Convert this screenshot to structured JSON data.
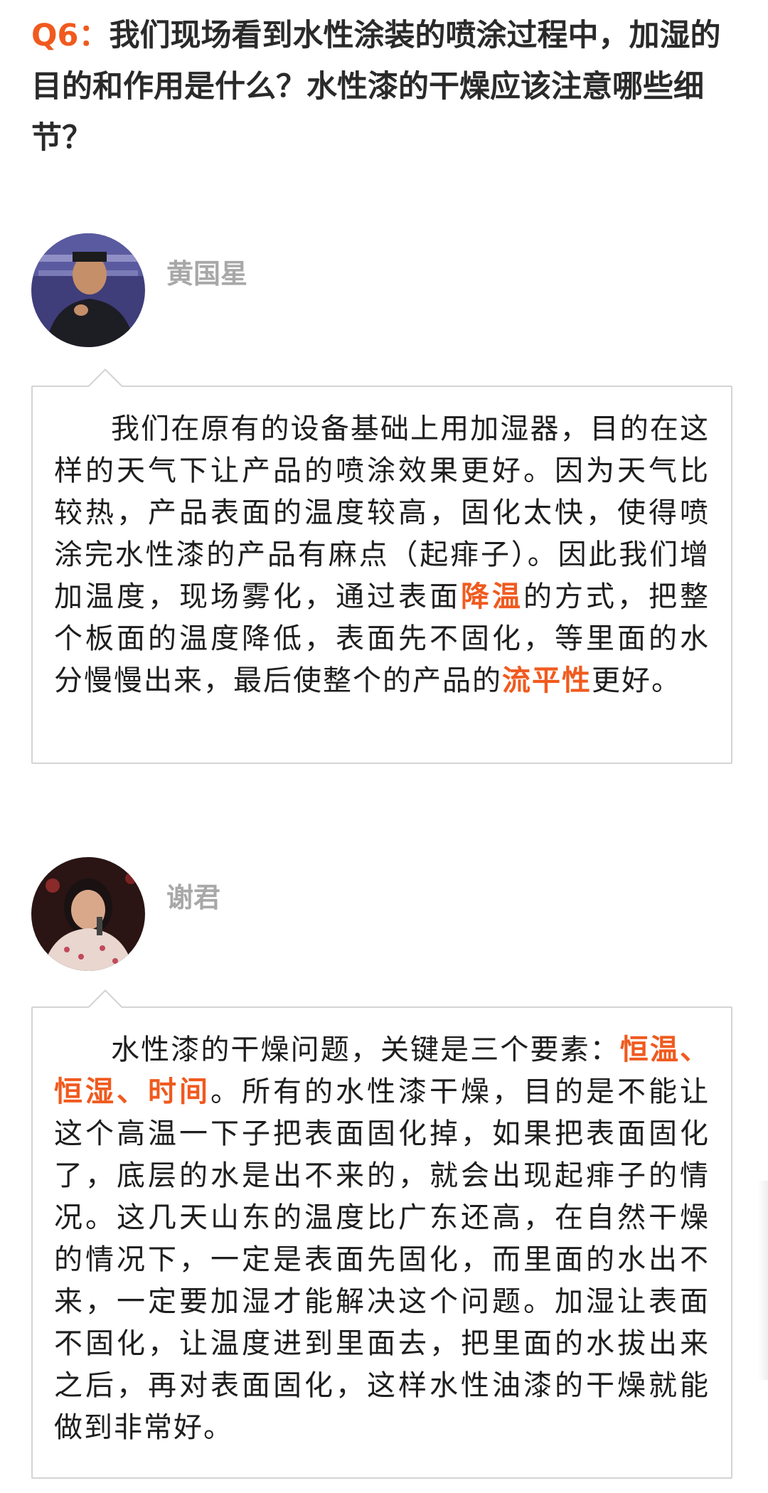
{
  "question": {
    "label": "Q6：",
    "text": "我们现场看到水性涂装的喷涂过程中，加湿的目的和作用是什么？水性漆的干燥应该注意哪些细节？"
  },
  "answers": [
    {
      "speaker": "黄国星",
      "avatar_icon": "speaker-photo-man",
      "segments": [
        {
          "text": "我们在原有的设备基础上用加湿器，目的在这样的天气下让产品的喷涂效果更好。因为天气比较热，产品表面的温度较高，固化太快，使得喷涂完水性漆的产品有麻点（起痱子）。因此我们增加温度，现场雾化，通过表面"
        },
        {
          "text": "降温"
        },
        {
          "text": "的方式，把整个板面的温度降低，表面先不固化，等里面的水分慢慢出来，最后使整个的产品的"
        },
        {
          "text": "流平性"
        },
        {
          "text": "更好。"
        }
      ]
    },
    {
      "speaker": "谢君",
      "avatar_icon": "speaker-photo-woman",
      "segments": [
        {
          "text": "水性漆的干燥问题，关键是三个要素："
        },
        {
          "text": "恒温、恒湿、时间"
        },
        {
          "text": "。所有的水性漆干燥，目的是不能让这个高温一下子把表面固化掉，如果把表面固化了，底层的水是出不来的，就会出现起痱子的情况。这几天山东的温度比广东还高，在自然干燥的情况下，一定是表面先固化，而里面的水出不来，一定要加湿才能解决这个问题。加湿让表面不固化，让温度进到里面去，把里面的水拔出来之后，再对表面固化，这样水性油漆的干燥就能做到非常好。"
        }
      ]
    }
  ],
  "colors": {
    "accent": "#f05a1e",
    "speaker_name": "#a8a8a8",
    "bubble_border": "#d4d4d4",
    "text": "#1e1e1e"
  }
}
